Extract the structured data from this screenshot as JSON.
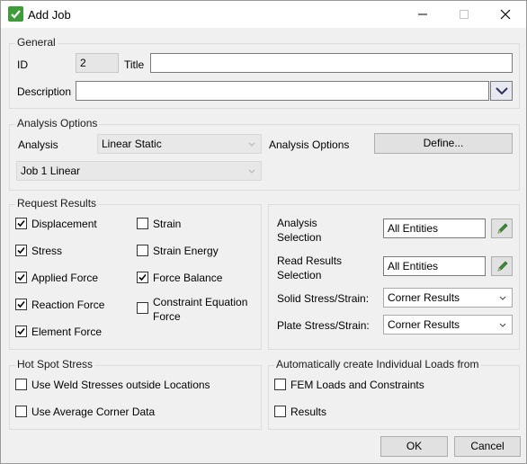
{
  "window": {
    "title": "Add Job"
  },
  "general": {
    "title": "General",
    "id_label": "ID",
    "id_value": "2",
    "title_label": "Title",
    "title_value": "",
    "description_label": "Description",
    "description_value": ""
  },
  "analysis_options": {
    "title": "Analysis Options",
    "analysis_label": "Analysis",
    "analysis_value": "Linear Static",
    "options_label": "Analysis Options",
    "define_button": "Define...",
    "job_value": "Job 1 Linear"
  },
  "request_results": {
    "title": "Request Results",
    "items": [
      {
        "label": "Displacement",
        "checked": true
      },
      {
        "label": "Stress",
        "checked": true
      },
      {
        "label": "Applied Force",
        "checked": true
      },
      {
        "label": "Reaction Force",
        "checked": true
      },
      {
        "label": "Element Force",
        "checked": true
      },
      {
        "label": "Strain",
        "checked": false
      },
      {
        "label": "Strain Energy",
        "checked": false
      },
      {
        "label": "Force Balance",
        "checked": true
      },
      {
        "label": "Constraint Equation Force",
        "checked": false
      }
    ]
  },
  "selection": {
    "analysis_selection_label": "Analysis Selection",
    "analysis_selection_value": "All Entities",
    "read_results_label": "Read Results Selection",
    "read_results_value": "All Entities",
    "solid_label": "Solid Stress/Strain:",
    "solid_value": "Corner Results",
    "plate_label": "Plate Stress/Strain:",
    "plate_value": "Corner Results"
  },
  "hot_spot": {
    "title": "Hot Spot Stress",
    "items": [
      {
        "label": "Use Weld Stresses outside Locations",
        "checked": false
      },
      {
        "label": "Use Average Corner Data",
        "checked": false
      }
    ]
  },
  "auto_loads": {
    "title": "Automatically create Individual Loads from",
    "items": [
      {
        "label": "FEM Loads and Constraints",
        "checked": false
      },
      {
        "label": "Results",
        "checked": false
      }
    ]
  },
  "buttons": {
    "ok": "OK",
    "cancel": "Cancel"
  }
}
